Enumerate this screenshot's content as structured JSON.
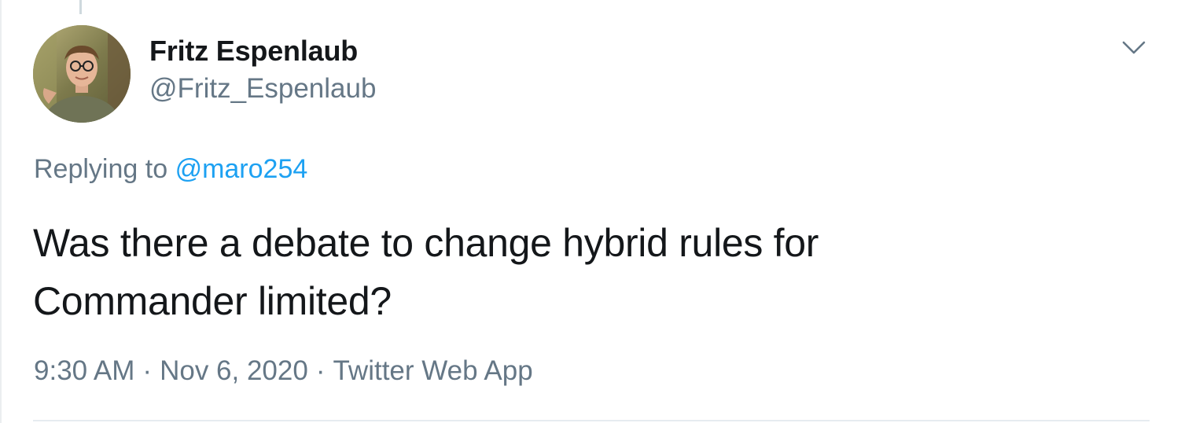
{
  "author": {
    "name": "Fritz Espenlaub",
    "handle": "@Fritz_Espenlaub"
  },
  "more_icon": "chevron-down-icon",
  "reply_context": {
    "prefix": "Replying to",
    "mention": "@maro254"
  },
  "tweet": {
    "text_line1": "Was there a debate to change hybrid rules for",
    "text_line2": "Commander limited?"
  },
  "meta": {
    "time": "9:30 AM",
    "separator": "·",
    "date": "Nov 6, 2020",
    "source": "Twitter Web App"
  },
  "colors": {
    "text_primary": "#14171a",
    "text_secondary": "#657786",
    "link_blue": "#1da1f2",
    "divider": "#e6ecf0"
  }
}
